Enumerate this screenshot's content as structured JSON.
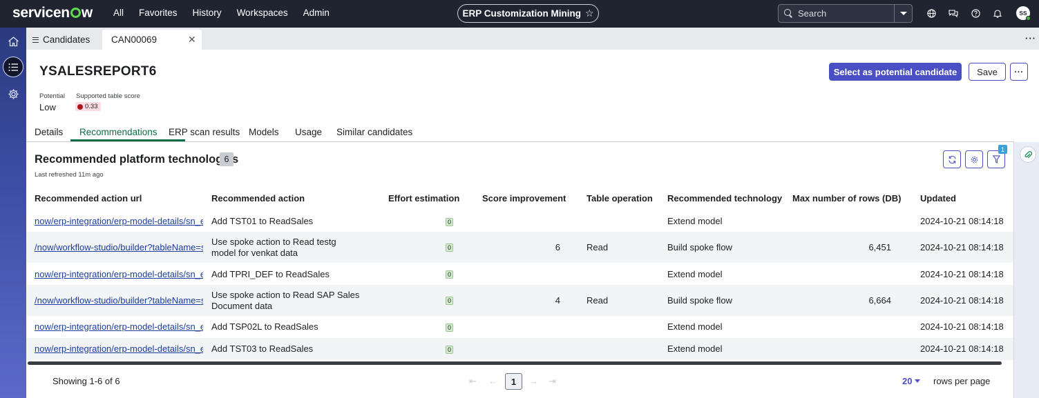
{
  "brand": {
    "logo": "servicenow"
  },
  "nav": [
    "All",
    "Favorites",
    "History",
    "Workspaces",
    "Admin"
  ],
  "app_pill": {
    "label": "ERP Customization Mining"
  },
  "search": {
    "placeholder": "Search"
  },
  "user": {
    "initials": "SS"
  },
  "tabs": {
    "list_label": "Candidates",
    "active_label": "CAN00069"
  },
  "record": {
    "title": "YSALESREPORT6",
    "primary_action": "Select as potential candidate",
    "save_label": "Save",
    "potential_label": "Potential",
    "potential_value": "Low",
    "score_label": "Supported table score",
    "score_value": "0.33"
  },
  "record_tabs": [
    "Details",
    "Recommendations",
    "ERP scan results",
    "Models",
    "Usage",
    "Similar candidates"
  ],
  "section": {
    "title": "Recommended platform technologies",
    "count": "6",
    "refreshed": "Last refreshed 11m ago",
    "filter_badge": "1"
  },
  "table": {
    "columns": [
      "Recommended action url",
      "Recommended action",
      "Effort estimation",
      "Score improvement",
      "Table operation",
      "Recommended technology",
      "Max number of rows (DB)",
      "Updated"
    ],
    "rows": [
      {
        "url": "now/erp-integration/erp-model-details/sn_erp",
        "action": "Add TST01 to ReadSales",
        "effort": "0",
        "score": "",
        "op": "",
        "tech": "Extend model",
        "rows_db": "",
        "updated": "2024-10-21 08:14:18"
      },
      {
        "url": "/now/workflow-studio/builder?tableName=sys_hub",
        "action": "Use spoke action to Read testg model for venkat data",
        "effort": "0",
        "score": "6",
        "op": "Read",
        "tech": "Build spoke flow",
        "rows_db": "6,451",
        "updated": "2024-10-21 08:14:18"
      },
      {
        "url": "now/erp-integration/erp-model-details/sn_erp",
        "action": "Add TPRI_DEF to ReadSales",
        "effort": "0",
        "score": "",
        "op": "",
        "tech": "Extend model",
        "rows_db": "",
        "updated": "2024-10-21 08:14:18"
      },
      {
        "url": "/now/workflow-studio/builder?tableName=sys_hub",
        "action": "Use spoke action to Read SAP Sales Document data",
        "effort": "0",
        "score": "4",
        "op": "Read",
        "tech": "Build spoke flow",
        "rows_db": "6,664",
        "updated": "2024-10-21 08:14:18"
      },
      {
        "url": "now/erp-integration/erp-model-details/sn_erp",
        "action": "Add TSP02L to ReadSales",
        "effort": "0",
        "score": "",
        "op": "",
        "tech": "Extend model",
        "rows_db": "",
        "updated": "2024-10-21 08:14:18"
      },
      {
        "url": "now/erp-integration/erp-model-details/sn_erp",
        "action": "Add TST03 to ReadSales",
        "effort": "0",
        "score": "",
        "op": "",
        "tech": "Extend model",
        "rows_db": "",
        "updated": "2024-10-21 08:14:18"
      }
    ]
  },
  "footer": {
    "showing": "Showing 1-6 of 6",
    "page": "1",
    "rows_per_page_value": "20",
    "rows_per_page_label": "rows per page"
  },
  "colors": {
    "topbar": "#1f2430",
    "brand_green": "#62d84e",
    "primary": "#4a4fc4",
    "tab_active": "#0f6d46",
    "link": "#1b3d9e",
    "score_red": "#b1121b"
  }
}
